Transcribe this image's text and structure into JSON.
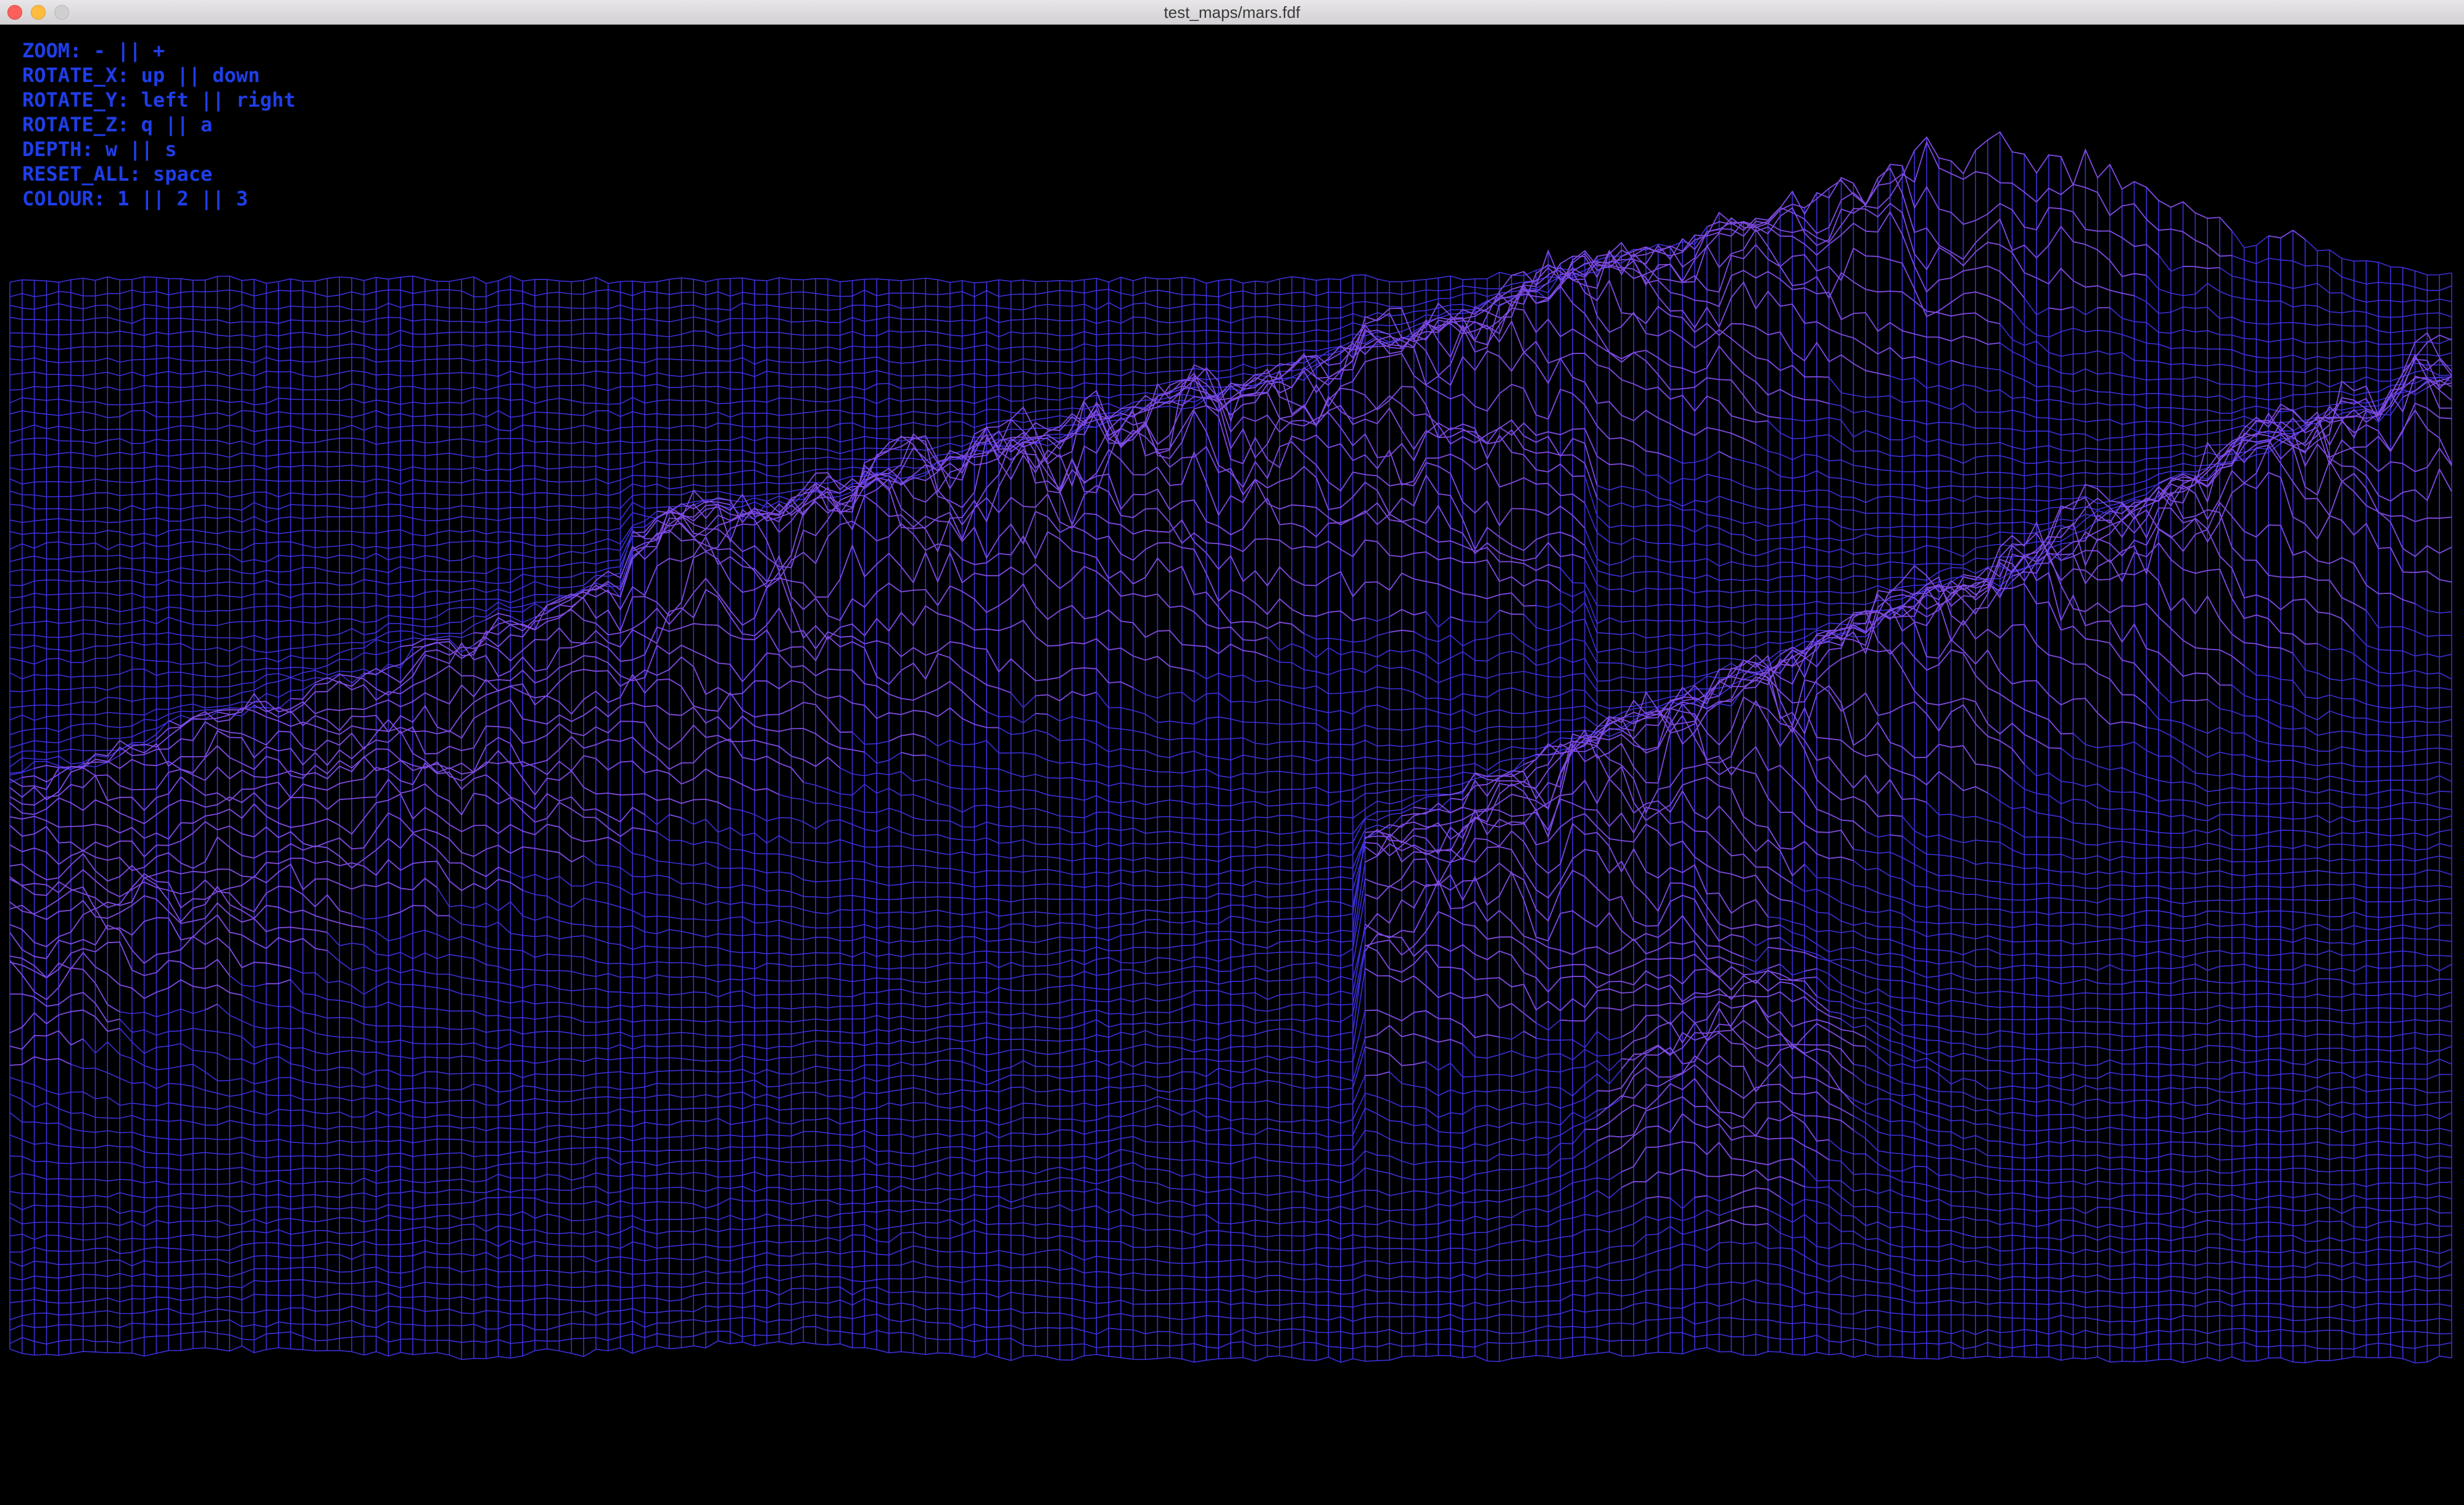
{
  "window": {
    "title": "test_maps/mars.fdf"
  },
  "controls": [
    {
      "text": "ZOOM: - || +"
    },
    {
      "text": "ROTATE_X: up || down"
    },
    {
      "text": "ROTATE_Y: left || right"
    },
    {
      "text": "ROTATE_Z: q || a"
    },
    {
      "text": "DEPTH: w || s"
    },
    {
      "text": "RESET_ALL: space"
    },
    {
      "text": "COLOUR: 1 || 2 || 3"
    }
  ],
  "colors": {
    "background": "#000000",
    "help_text": "#1f3ee8",
    "wire_low": "#3b2fd9",
    "wire_high": "#8a4fe0"
  }
}
